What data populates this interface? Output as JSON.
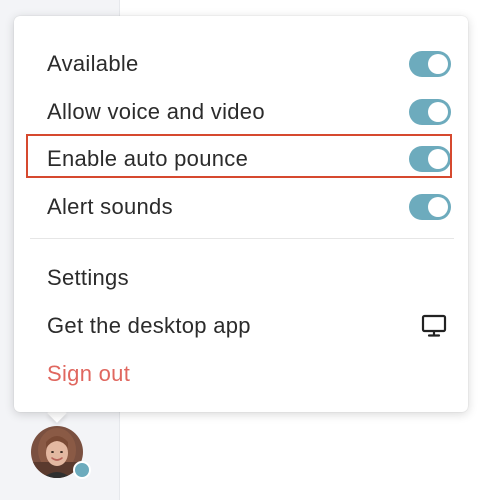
{
  "menu": {
    "toggles": [
      {
        "label": "Available",
        "enabled": true
      },
      {
        "label": "Allow voice and video",
        "enabled": true
      },
      {
        "label": "Enable auto pounce",
        "enabled": true
      },
      {
        "label": "Alert sounds",
        "enabled": true
      }
    ],
    "settings_label": "Settings",
    "desktop_app_label": "Get the desktop app",
    "desktop_app_icon": "monitor-icon",
    "sign_out_label": "Sign out"
  },
  "user": {
    "status_color": "#6dabbd"
  },
  "colors": {
    "toggle_on": "#6dabbd",
    "highlight": "#d6492f",
    "sign_out": "#e0675f"
  }
}
